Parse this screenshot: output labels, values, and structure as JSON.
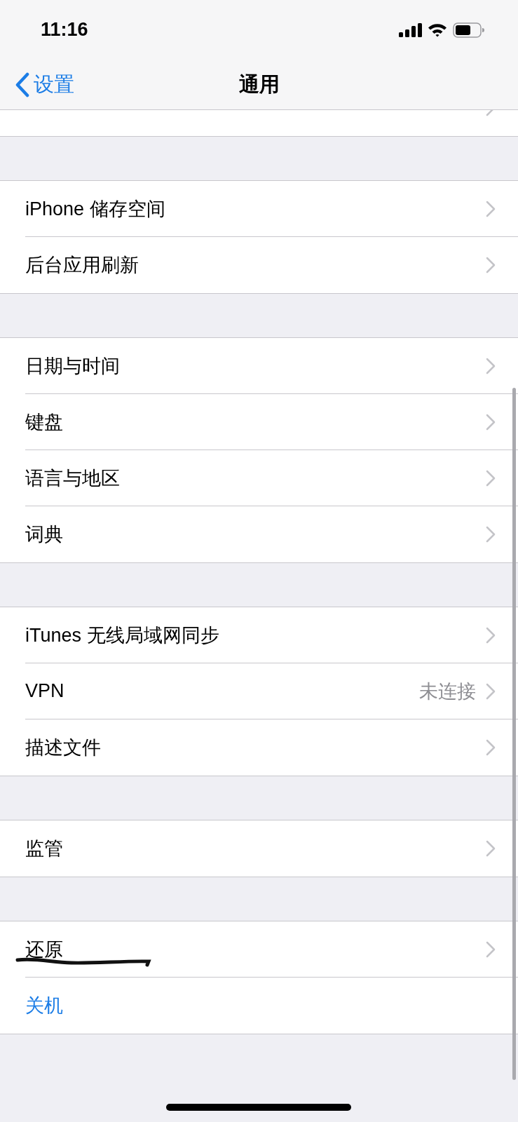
{
  "status_bar": {
    "time": "11:16"
  },
  "nav": {
    "back": "设置",
    "title": "通用"
  },
  "groups": [
    {
      "rows": [
        {
          "kind": "link",
          "underlined": false
        }
      ]
    },
    {
      "rows": [
        {
          "label": "iPhone 储存空间",
          "kind": "link",
          "underlined": false
        },
        {
          "label": "后台应用刷新",
          "kind": "link",
          "underlined": false
        }
      ]
    },
    {
      "rows": [
        {
          "label": "日期与时间",
          "kind": "link",
          "underlined": false
        },
        {
          "label": "键盘",
          "kind": "link",
          "underlined": false
        },
        {
          "label": "语言与地区",
          "kind": "link",
          "underlined": false
        },
        {
          "label": "词典",
          "kind": "link",
          "underlined": false
        }
      ]
    },
    {
      "rows": [
        {
          "label": "iTunes 无线局域网同步",
          "kind": "link",
          "underlined": false
        },
        {
          "label": "VPN",
          "value": "未连接",
          "kind": "link",
          "underlined": false
        },
        {
          "label": "描述文件",
          "kind": "link",
          "underlined": false
        }
      ]
    },
    {
      "rows": [
        {
          "label": "监管",
          "kind": "link",
          "underlined": false
        }
      ]
    },
    {
      "rows": [
        {
          "label": "还原",
          "kind": "link",
          "underlined": true
        },
        {
          "label": "关机",
          "kind": "action",
          "underlined": false
        }
      ]
    }
  ]
}
